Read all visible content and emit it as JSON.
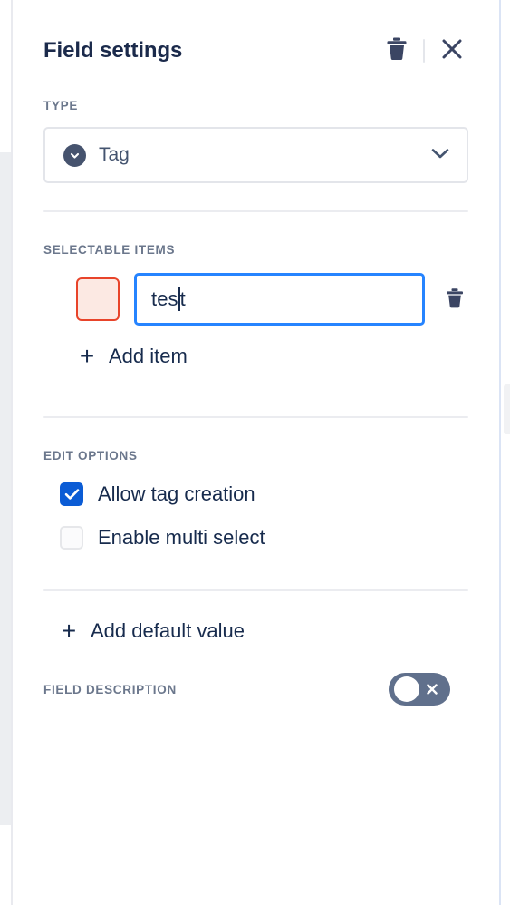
{
  "header": {
    "title": "Field settings",
    "delete_icon": "trash-icon",
    "close_icon": "close-icon"
  },
  "type_section": {
    "label": "TYPE",
    "selected_value": "Tag",
    "badge_icon": "chevron-down-circle-icon",
    "dropdown_icon": "chevron-down-icon"
  },
  "selectable_items": {
    "label": "SELECTABLE ITEMS",
    "items": [
      {
        "value": "test",
        "value_before_caret": "tes",
        "value_after_caret": "t",
        "swatch_border_color": "#e8442a",
        "swatch_fill_color": "#fce9e3",
        "delete_icon": "trash-icon"
      }
    ],
    "add_item_label": "Add item",
    "add_item_icon": "plus-icon"
  },
  "edit_options": {
    "label": "EDIT OPTIONS",
    "options": [
      {
        "label": "Allow tag creation",
        "checked": true
      },
      {
        "label": "Enable multi select",
        "checked": false
      }
    ]
  },
  "default_value": {
    "label": "Add default value",
    "icon": "plus-icon"
  },
  "field_description": {
    "label": "FIELD DESCRIPTION",
    "toggle_state": "off",
    "toggle_icon": "close-icon"
  },
  "colors": {
    "accent_blue": "#0b5cd5",
    "focus_blue": "#2684ff",
    "text_dark": "#172b4d",
    "label_gray": "#6b778c",
    "icon_slate": "#44546f",
    "toggle_gray": "#60708c",
    "divider": "#ebecf0"
  }
}
